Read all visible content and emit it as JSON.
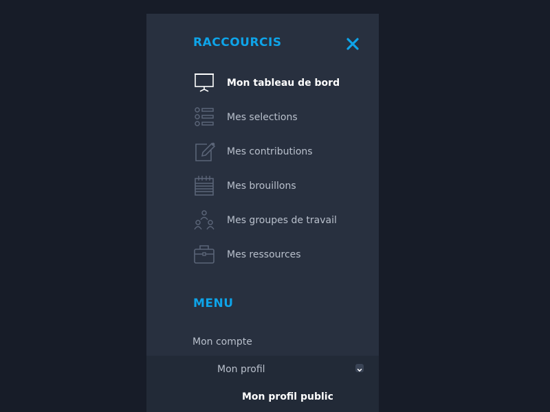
{
  "raccourcis": {
    "title": "RACCOURCIS",
    "items": [
      {
        "label": "Mon tableau de bord",
        "icon": "dashboard-presentation-icon",
        "active": true
      },
      {
        "label": "Mes selections",
        "icon": "list-icon"
      },
      {
        "label": "Mes contributions",
        "icon": "edit-icon"
      },
      {
        "label": "Mes brouillons",
        "icon": "notepad-icon"
      },
      {
        "label": "Mes groupes de travail",
        "icon": "group-icon"
      },
      {
        "label": "Mes ressources",
        "icon": "briefcase-icon"
      }
    ]
  },
  "menu": {
    "title": "MENU",
    "account": "Mon compte",
    "profile": "Mon profil",
    "public_profile": "Mon profil public"
  },
  "colors": {
    "accent": "#0ea4e9",
    "page_bg": "#171c28",
    "panel_bg": "#28303f",
    "text": "#b9c0cc",
    "active_text": "#ffffff"
  }
}
